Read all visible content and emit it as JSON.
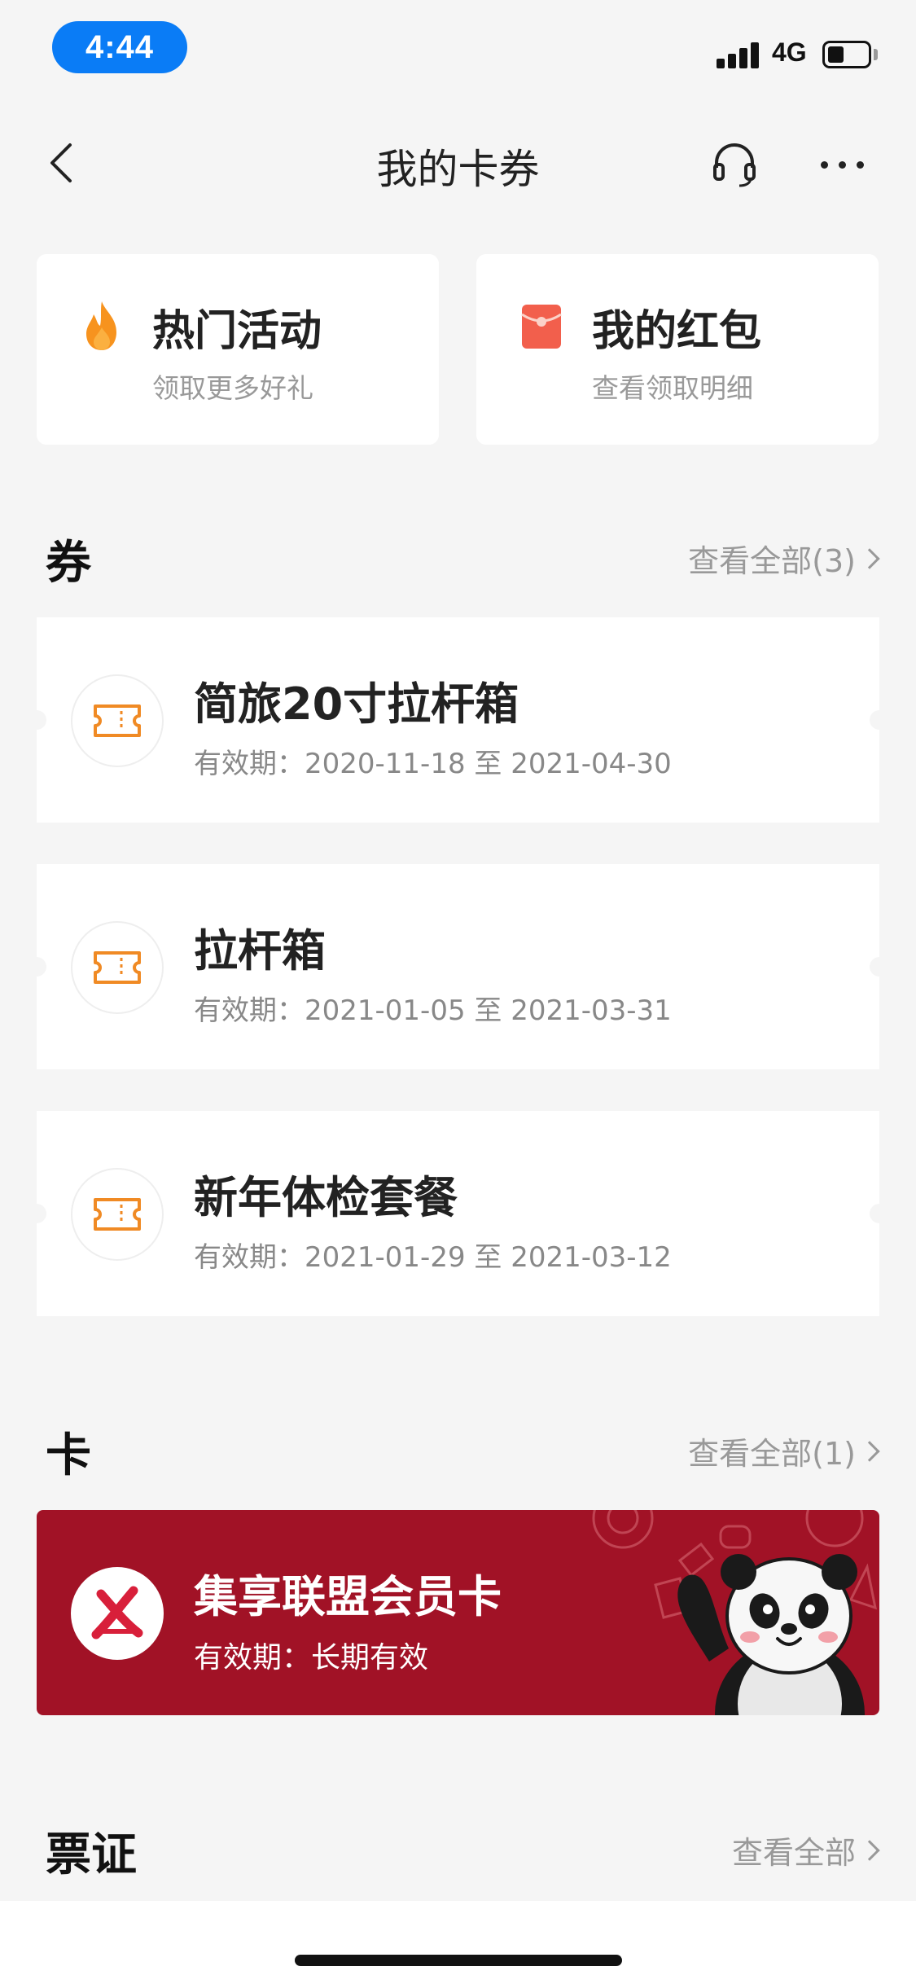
{
  "status_bar": {
    "time": "4:44",
    "network": "4G",
    "battery_level": 0.42
  },
  "nav": {
    "title": "我的卡券",
    "back_icon": "chevron-left-icon",
    "support_icon": "headset-icon",
    "more_icon": "more-dots-icon"
  },
  "quick_actions": [
    {
      "title": "热门活动",
      "subtitle": "领取更多好礼",
      "icon": "flame-icon",
      "color": "#f7931e"
    },
    {
      "title": "我的红包",
      "subtitle": "查看领取明细",
      "icon": "red-envelope-icon",
      "color": "#f25f4c"
    }
  ],
  "coupons_section": {
    "title": "券",
    "view_all": "查看全部(3)"
  },
  "coupons": [
    {
      "title": "简旅20寸拉杆箱",
      "validity_label": "有效期：",
      "validity": "2020-11-18 至 2021-04-30"
    },
    {
      "title": "拉杆箱",
      "validity_label": "有效期：",
      "validity": "2021-01-05 至 2021-03-31"
    },
    {
      "title": "新年体检套餐",
      "validity_label": "有效期：",
      "validity": "2021-01-29 至 2021-03-12"
    }
  ],
  "cards_section": {
    "title": "卡",
    "view_all": "查看全部(1)"
  },
  "member_card": {
    "title": "集享联盟会员卡",
    "validity_label": "有效期：",
    "validity": "长期有效",
    "bg_color": "#a11226"
  },
  "tickets_section": {
    "title": "票证",
    "view_all": "查看全部"
  },
  "colors": {
    "accent_orange": "#f08a24",
    "page_bg": "#f5f5f5",
    "status_pill": "#0a7cf6"
  }
}
